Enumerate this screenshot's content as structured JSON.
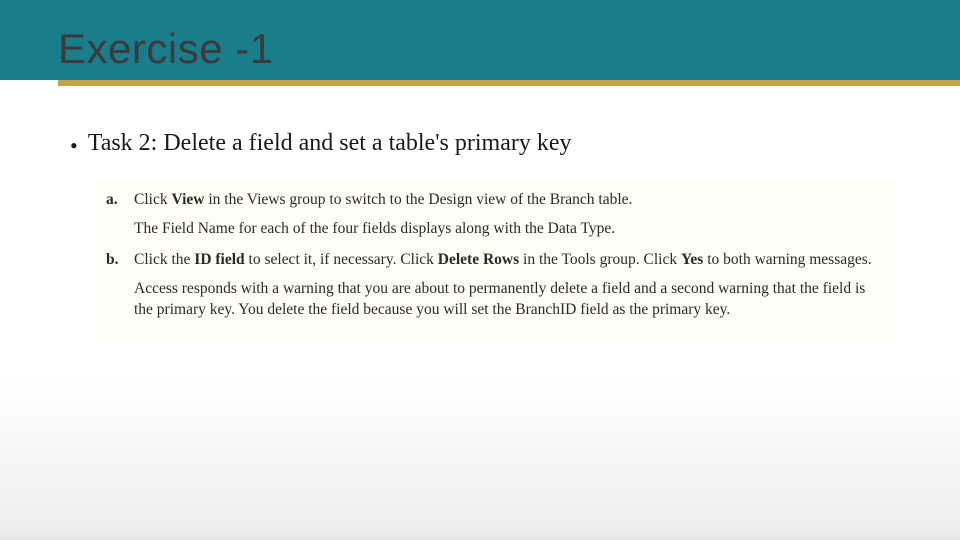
{
  "slide": {
    "title": "Exercise -1",
    "task_bullet": "Task 2: Delete a field and set a table's primary key"
  },
  "steps": {
    "a": {
      "label": "a.",
      "pre": "Click ",
      "bold1": "View",
      "post": " in the Views group to switch to the Design view of the Branch table.",
      "note": "The Field Name for each of the four fields displays along with the Data Type."
    },
    "b": {
      "label": "b.",
      "seg1": "Click the ",
      "bold1": "ID field",
      "seg2": " to select it, if necessary. Click ",
      "bold2": "Delete Rows",
      "seg3": " in the Tools group. Click ",
      "bold3": "Yes",
      "seg4": " to both warning messages.",
      "note": "Access responds with a warning that you are about to permanently delete a field and a second warning that the field is the primary key. You delete the field because you will set the BranchID field as the primary key."
    }
  }
}
